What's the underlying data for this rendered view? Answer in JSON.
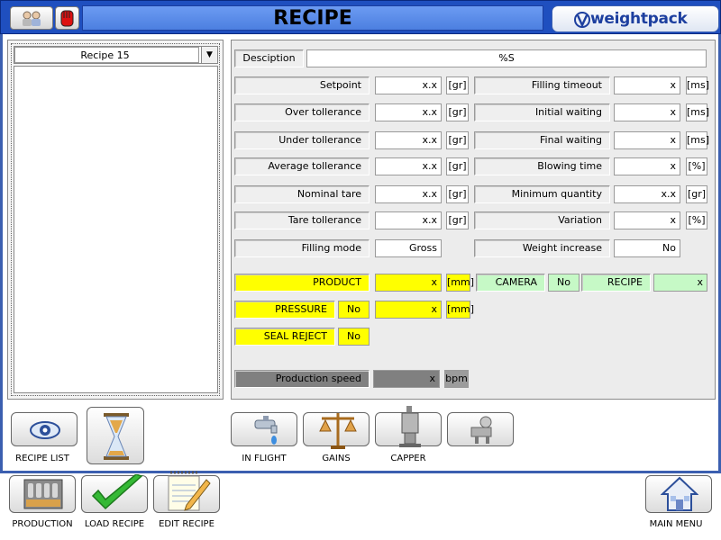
{
  "title": "RECIPE",
  "brand": "weightpack",
  "left": {
    "selected_recipe": "Recipe 15"
  },
  "description": {
    "label": "Desciption",
    "value": "%S"
  },
  "rows": [
    {
      "l_label": "Setpoint",
      "l_value": "x.x",
      "l_unit": "[gr]",
      "r_label": "Filling timeout",
      "r_value": "x",
      "r_unit": "[ms]"
    },
    {
      "l_label": "Over tollerance",
      "l_value": "x.x",
      "l_unit": "[gr]",
      "r_label": "Initial waiting",
      "r_value": "x",
      "r_unit": "[ms]"
    },
    {
      "l_label": "Under tollerance",
      "l_value": "x.x",
      "l_unit": "[gr]",
      "r_label": "Final waiting",
      "r_value": "x",
      "r_unit": "[ms]"
    },
    {
      "l_label": "Average tollerance",
      "l_value": "x.x",
      "l_unit": "[gr]",
      "r_label": "Blowing time",
      "r_value": "x",
      "r_unit": "[%]"
    },
    {
      "l_label": "Nominal tare",
      "l_value": "x.x",
      "l_unit": "[gr]",
      "r_label": "Minimum quantity",
      "r_value": "x.x",
      "r_unit": "[gr]"
    },
    {
      "l_label": "Tare tollerance",
      "l_value": "x.x",
      "l_unit": "[gr]",
      "r_label": "Variation",
      "r_value": "x",
      "r_unit": "[%]"
    }
  ],
  "filling_mode": {
    "label": "Filling mode",
    "value": "Gross"
  },
  "weight_increase": {
    "label": "Weight increase",
    "value": "No"
  },
  "product": {
    "label": "PRODUCT",
    "value": "x",
    "unit": "[mm]"
  },
  "camera": {
    "label": "CAMERA",
    "value": "No"
  },
  "recipe_field": {
    "label": "RECIPE",
    "value": "x"
  },
  "pressure": {
    "label": "PRESSURE",
    "value": "No",
    "value2": "x",
    "unit": "[mm]"
  },
  "seal_reject": {
    "label": "SEAL REJECT",
    "value": "No"
  },
  "production_speed": {
    "label": "Production speed",
    "value": "x",
    "unit": "bpm"
  },
  "buttons": {
    "recipe_list": "RECIPE LIST",
    "in_flight": "IN FLIGHT",
    "gains": "GAINS",
    "capper": "CAPPER",
    "production": "PRODUCTION",
    "load_recipe": "LOAD RECIPE",
    "edit_recipe": "EDIT RECIPE",
    "main_menu": "MAIN MENU"
  },
  "colors": {
    "title_bar": "#1f4fbf",
    "title_band": "#6c9bf2",
    "highlight_yellow": "#ffff00",
    "highlight_green": "#c6f9c6",
    "speed_grey": "#808080"
  }
}
